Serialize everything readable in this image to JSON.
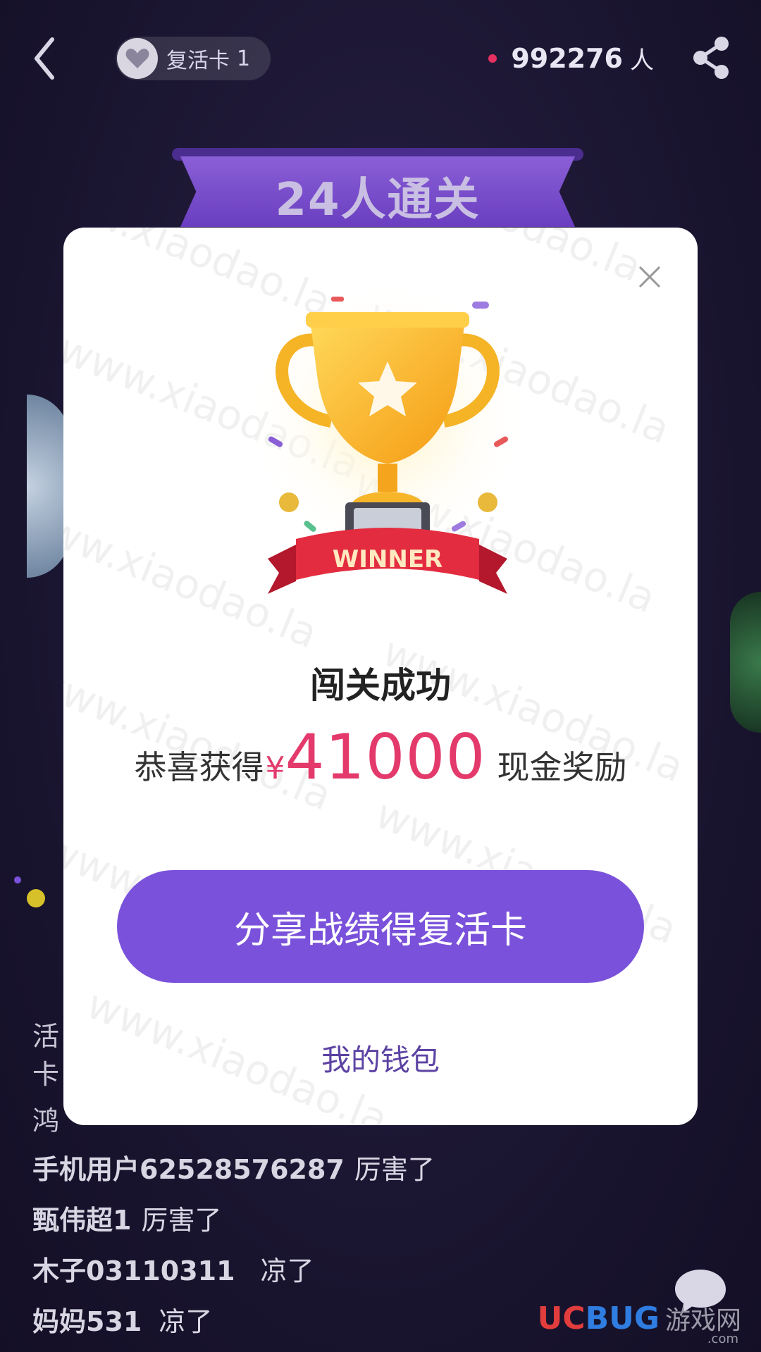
{
  "topbar": {
    "revive_label": "复活卡",
    "revive_count": "1",
    "online_count": "992276",
    "online_unit": "人"
  },
  "banner": {
    "text": "24人通关"
  },
  "modal": {
    "trophy_label": "WINNER",
    "title": "闯关成功",
    "reward_prefix": "恭喜获得",
    "reward_currency": "¥",
    "reward_amount": "41000",
    "reward_suffix": "现金奖励",
    "share_button": "分享战绩得复活卡",
    "wallet_link": "我的钱包",
    "watermark": "www.xiaodao.la"
  },
  "comments_partial": [
    "活",
    "卡",
    "鸿"
  ],
  "comments": [
    {
      "user": "手机用户62528576287",
      "msg": "厉害了"
    },
    {
      "user": "甄伟超1",
      "msg": "厉害了"
    },
    {
      "user": "木子03110311",
      "msg": "凉了"
    },
    {
      "user": "妈妈531",
      "msg": "凉了"
    }
  ],
  "site_logo": {
    "uc": "UC",
    "bug": "BUG",
    "cn": "游戏网",
    "com": ".com"
  },
  "colors": {
    "accent": "#7a51da",
    "reward": "#e33a6b",
    "background": "#1a1530"
  }
}
